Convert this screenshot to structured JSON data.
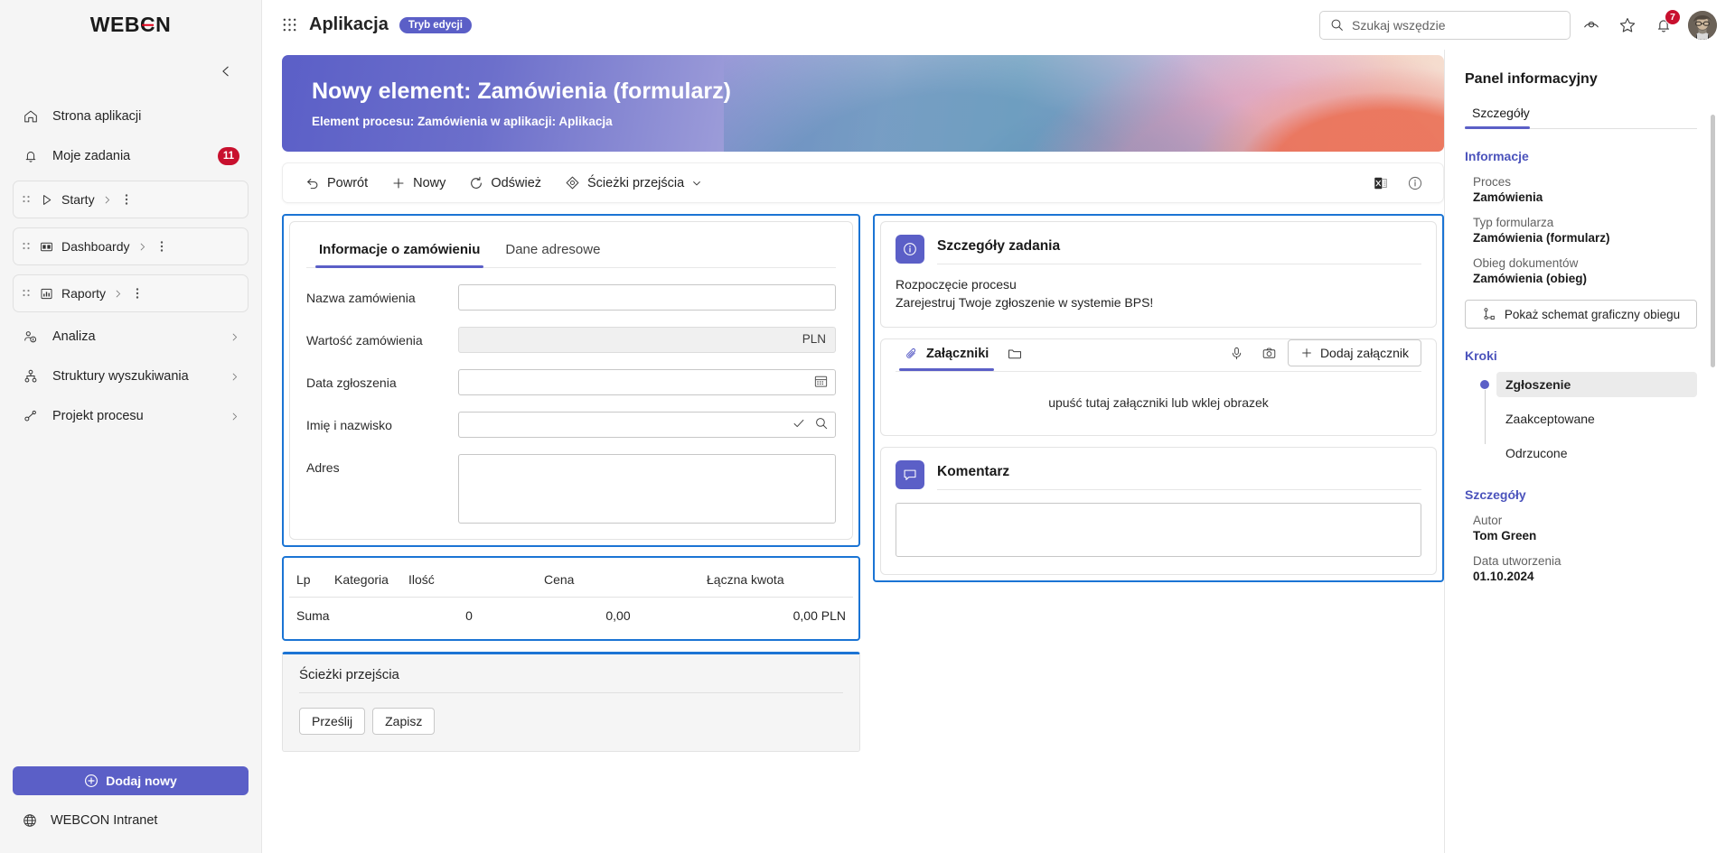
{
  "brand": {
    "logo_pre": "WEB",
    "logo_o": "C",
    "logo_post": "N",
    "accent": "#5b5fc7",
    "red": "#c8102e",
    "highlight": "#1b74d4"
  },
  "sidebar": {
    "items": [
      {
        "label": "Strona aplikacji",
        "icon": "home-icon"
      },
      {
        "label": "Moje zadania",
        "icon": "bell-icon",
        "badge": "11"
      },
      {
        "label": "Starty",
        "icon": "play-icon",
        "card": true
      },
      {
        "label": "Dashboardy",
        "icon": "dashboard-icon",
        "card": true
      },
      {
        "label": "Raporty",
        "icon": "report-icon",
        "card": true
      },
      {
        "label": "Analiza",
        "icon": "analysis-icon"
      },
      {
        "label": "Struktury wyszukiwania",
        "icon": "structures-icon"
      },
      {
        "label": "Projekt procesu",
        "icon": "process-design-icon"
      }
    ],
    "add_new_label": "Dodaj nowy",
    "intranet_label": "WEBCON Intranet"
  },
  "topbar": {
    "app_title": "Aplikacja",
    "mode_badge": "Tryb edycji",
    "search_placeholder": "Szukaj wszędzie",
    "search_value": "",
    "notifications_count": "7"
  },
  "banner": {
    "title": "Nowy element: Zamówienia (formularz)",
    "subtitle": "Element procesu: Zamówienia w aplikacji: Aplikacja"
  },
  "toolbar": {
    "buttons": [
      {
        "label": "Powrót",
        "icon": "back-arrow-icon"
      },
      {
        "label": "Nowy",
        "icon": "plus-icon"
      },
      {
        "label": "Odśwież",
        "icon": "refresh-icon"
      },
      {
        "label": "Ścieżki przejścia",
        "icon": "paths-icon",
        "caret": true
      }
    ]
  },
  "form": {
    "tabs": [
      {
        "label": "Informacje o zamówieniu",
        "active": true
      },
      {
        "label": "Dane adresowe",
        "active": false
      }
    ],
    "fields": [
      {
        "label": "Nazwa zamówienia",
        "type": "text",
        "value": "",
        "readonly": false
      },
      {
        "label": "Wartość zamówienia",
        "type": "text",
        "value": "",
        "readonly": true,
        "suffix": "PLN"
      },
      {
        "label": "Data zgłoszenia",
        "type": "date",
        "value": ""
      },
      {
        "label": "Imię i nazwisko",
        "type": "picker",
        "value": ""
      },
      {
        "label": "Adres",
        "type": "textarea",
        "value": ""
      }
    ]
  },
  "table": {
    "columns": [
      "Lp",
      "Kategoria",
      "Ilość",
      "Cena",
      "Łączna kwota"
    ],
    "rows": [
      {
        "lp": "Suma",
        "kategoria": "",
        "ilosc": "0",
        "cena": "0,00",
        "kwota": "0,00 PLN"
      }
    ]
  },
  "task_details": {
    "title": "Szczegóły zadania",
    "line1": "Rozpoczęcie procesu",
    "line2": "Zarejestruj Twoje zgłoszenie w systemie BPS!"
  },
  "attachments": {
    "tab_label": "Załączniki",
    "add_label": "Dodaj załącznik",
    "drop_hint": "upuść tutaj załączniki lub wklej obrazek"
  },
  "comment": {
    "title": "Komentarz",
    "value": ""
  },
  "paths": {
    "title": "Ścieżki przejścia",
    "submit_label": "Prześlij",
    "save_label": "Zapisz"
  },
  "info_panel": {
    "title": "Panel informacyjny",
    "tab": "Szczegóły",
    "section_info": "Informacje",
    "info_items": [
      {
        "key": "Proces",
        "value": "Zamówienia"
      },
      {
        "key": "Typ formularza",
        "value": "Zamówienia (formularz)"
      },
      {
        "key": "Obieg dokumentów",
        "value": "Zamówienia (obieg)"
      }
    ],
    "schema_button": "Pokaż schemat graficzny obiegu",
    "section_steps": "Kroki",
    "steps": [
      {
        "label": "Zgłoszenie",
        "active": true
      },
      {
        "label": "Zaakceptowane",
        "active": false
      },
      {
        "label": "Odrzucone",
        "active": false
      }
    ],
    "section_details": "Szczegóły",
    "detail_items": [
      {
        "key": "Autor",
        "value": "Tom Green"
      },
      {
        "key": "Data utworzenia",
        "value": "01.10.2024"
      }
    ]
  }
}
